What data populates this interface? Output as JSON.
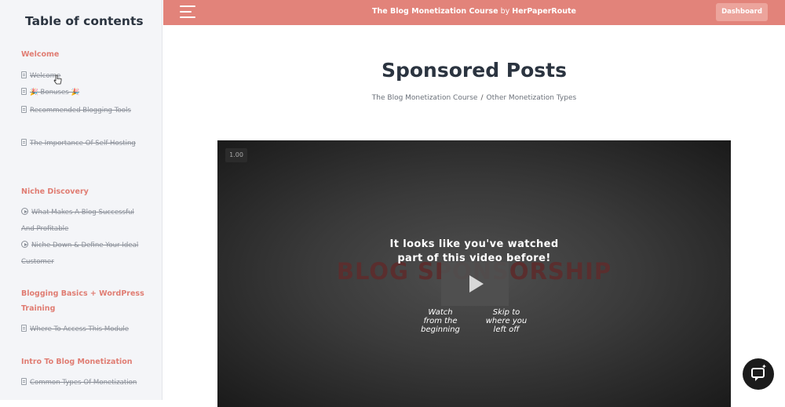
{
  "sidebar": {
    "title": "Table of contents",
    "sections": [
      {
        "title": "Welcome"
      },
      {
        "title": "Niche Discovery"
      },
      {
        "title": "Blogging Basics + WordPress Training"
      },
      {
        "title": "Intro To Blog Monetization"
      }
    ],
    "lessons": [
      {
        "label": "Welcome",
        "icon": "document-icon"
      },
      {
        "label": "🎉 Bonuses 🎉",
        "icon": "document-icon"
      },
      {
        "label": "Recommended Blogging Tools",
        "icon": "document-icon"
      },
      {
        "label": "The Importance Of Self-Hosting",
        "icon": "document-icon"
      },
      {
        "label": "What Makes A Blog Successful And Profitable",
        "icon": "play-circle-icon"
      },
      {
        "label": "Niche Down & Define Your Ideal Customer",
        "icon": "play-circle-icon"
      },
      {
        "label": "Where To Access This Module",
        "icon": "document-icon"
      },
      {
        "label": "Common Types Of Monetization",
        "icon": "document-icon"
      }
    ]
  },
  "topbar": {
    "course_name": "The Blog Monetization Course",
    "by_text": "by",
    "author": "HerPaperRoute",
    "dashboard_label": "Dashboard",
    "bg_color": "#e2837a"
  },
  "main": {
    "page_title": "Sponsored Posts",
    "breadcrumb": [
      "The Blog Monetization Course",
      "/",
      "Other Monetization Types"
    ]
  },
  "video": {
    "speed": "1.00",
    "background_text": "BLOG SPONSORSHIP",
    "resume_message_line1": "It looks like you've watched",
    "resume_message_line2": "part of this video before!",
    "option_watch_beginning": [
      "Watch",
      "from the",
      "beginning"
    ],
    "option_skip": [
      "Skip to",
      "where you",
      "left off"
    ]
  },
  "chat": {
    "icon": "chat-sparkle-icon"
  },
  "accent_color": "#e07d73"
}
